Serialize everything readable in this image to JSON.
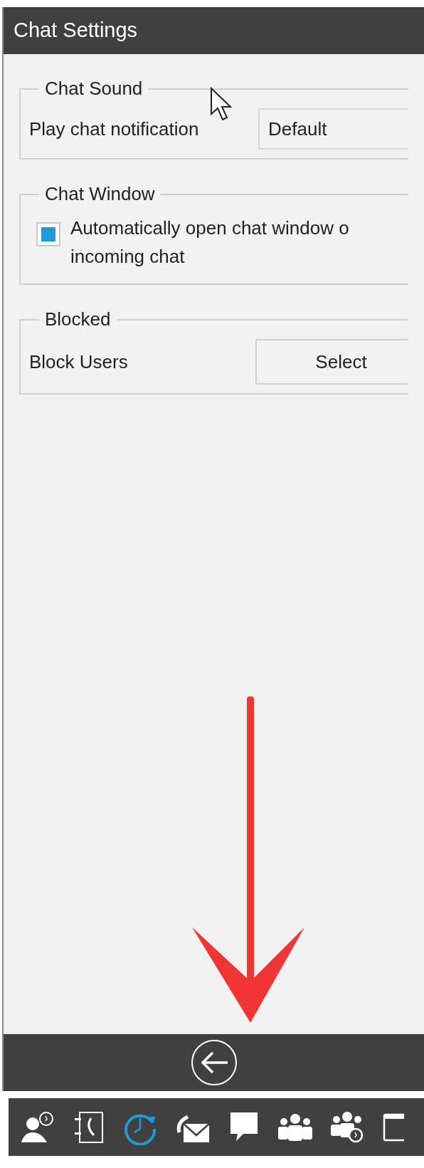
{
  "window": {
    "title": "Chat Settings"
  },
  "groups": [
    {
      "kind": "dropdown",
      "title": "Chat Sound",
      "label": "Play chat notification",
      "value": "Default"
    },
    {
      "kind": "checkbox",
      "title": "Chat Window",
      "lines": [
        "Automatically open chat window o",
        "incoming chat"
      ],
      "checked": true
    },
    {
      "kind": "button",
      "title": "Blocked",
      "label": "Block Users",
      "button": "Select"
    }
  ],
  "toolbar": [
    {
      "kind": "contact",
      "selected": false
    },
    {
      "kind": "phonebook",
      "selected": false
    },
    {
      "kind": "history",
      "selected": true
    },
    {
      "kind": "voicemail",
      "selected": false
    },
    {
      "kind": "chat",
      "selected": false
    },
    {
      "kind": "group",
      "selected": false
    },
    {
      "kind": "grouptimer",
      "selected": false
    },
    {
      "kind": "window",
      "selected": false
    }
  ]
}
